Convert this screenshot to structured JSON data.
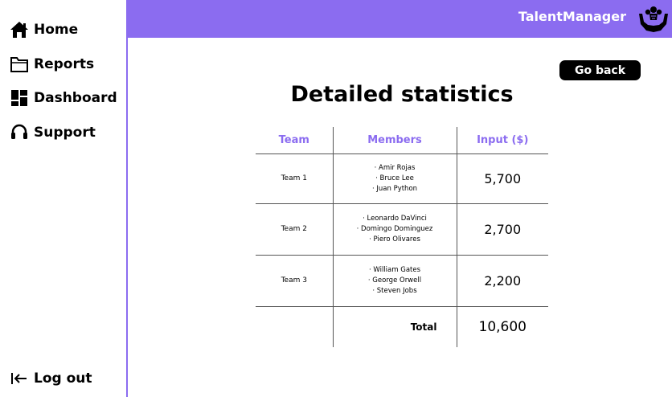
{
  "nav": {
    "home": "Home",
    "reports": "Reports",
    "dashboard": "Dashboard",
    "support": "Support",
    "logout": "Log out"
  },
  "header": {
    "app_name": "TalentManager",
    "accent_color": "#8b6cf0"
  },
  "actions": {
    "go_back": "Go back"
  },
  "page": {
    "title": "Detailed statistics"
  },
  "table": {
    "headers": [
      "Team",
      "Members",
      "Input ($)"
    ],
    "rows": [
      {
        "team": "Team 1",
        "members": [
          "· Amir Rojas",
          "· Bruce Lee",
          "· Juan Python"
        ],
        "input": "5,700"
      },
      {
        "team": "Team 2",
        "members": [
          "· Leonardo DaVinci",
          "· Domingo Dominguez",
          "· Piero Olivares"
        ],
        "input": "2,700"
      },
      {
        "team": "Team 3",
        "members": [
          "· William Gates",
          "· George Orwell",
          "· Steven Jobs"
        ],
        "input": "2,200"
      }
    ],
    "total_label": "Total",
    "total_value": "10,600"
  }
}
